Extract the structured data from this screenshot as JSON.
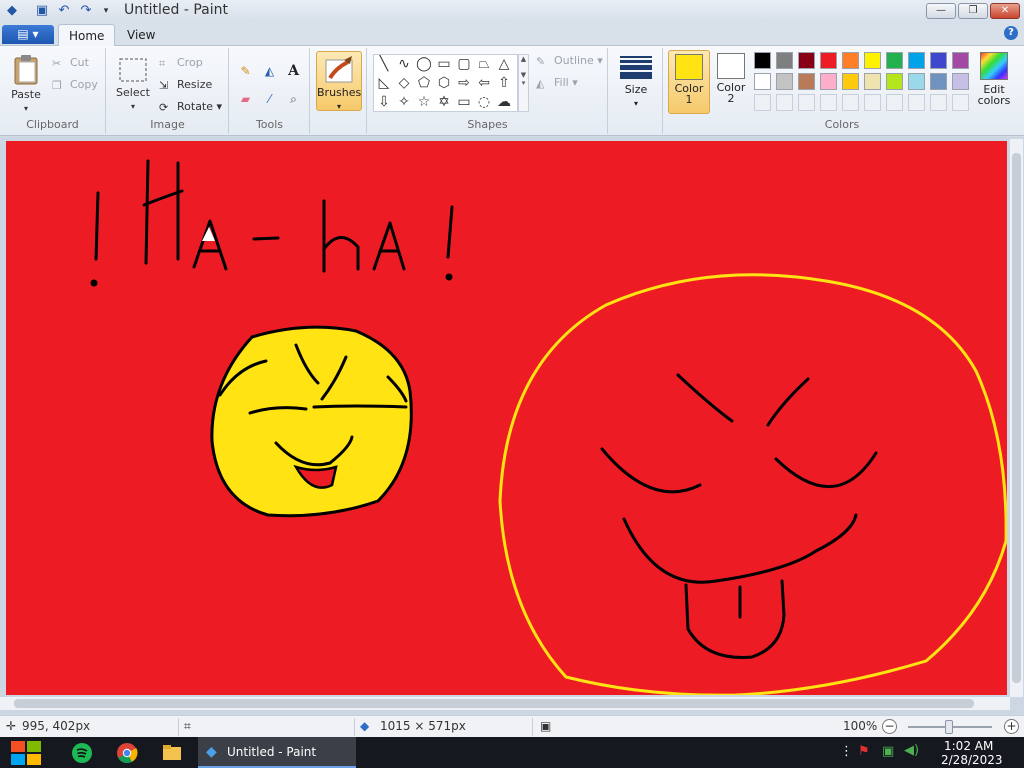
{
  "window": {
    "title": "Untitled - Paint",
    "min": "—",
    "max": "❐",
    "close": "✕"
  },
  "tabs": {
    "file": "▤ ▾",
    "home": "Home",
    "view": "View",
    "help": "?"
  },
  "ribbon": {
    "clipboard": {
      "label": "Clipboard",
      "paste": "Paste",
      "cut": "Cut",
      "copy": "Copy"
    },
    "image": {
      "label": "Image",
      "select": "Select",
      "crop": "Crop",
      "resize": "Resize",
      "rotate": "Rotate ▾"
    },
    "tools": {
      "label": "Tools"
    },
    "brushes": {
      "label": "Brushes"
    },
    "shapes": {
      "label": "Shapes",
      "outline": "Outline ▾",
      "fill": "Fill ▾"
    },
    "size": {
      "label": "Size"
    },
    "color1": {
      "label1": "Color",
      "label2": "1",
      "value": "#ffe312"
    },
    "color2": {
      "label1": "Color",
      "label2": "2",
      "value": "#ffffff"
    },
    "colors": {
      "label": "Colors"
    },
    "edit_colors": {
      "label1": "Edit",
      "label2": "colors"
    },
    "palette_row1": [
      "#000000",
      "#7f7f7f",
      "#880015",
      "#ed1c24",
      "#ff7f27",
      "#fff200",
      "#22b14c",
      "#00a2e8",
      "#3f48cc",
      "#a349a4"
    ],
    "palette_row2": [
      "#ffffff",
      "#c3c3c3",
      "#b97a57",
      "#ffaec9",
      "#ffc90e",
      "#efe4b0",
      "#b5e61d",
      "#99d9ea",
      "#7092be",
      "#c8bfe7"
    ]
  },
  "canvas": {
    "background": "#ed1c24",
    "text": "Ha-ha!"
  },
  "status": {
    "cursor": "995, 402px",
    "dimensions": "1015 × 571px",
    "zoom": "100%"
  },
  "taskbar": {
    "app_label": "Untitled - Paint",
    "time": "1:02 AM",
    "date": "2/28/2023"
  }
}
